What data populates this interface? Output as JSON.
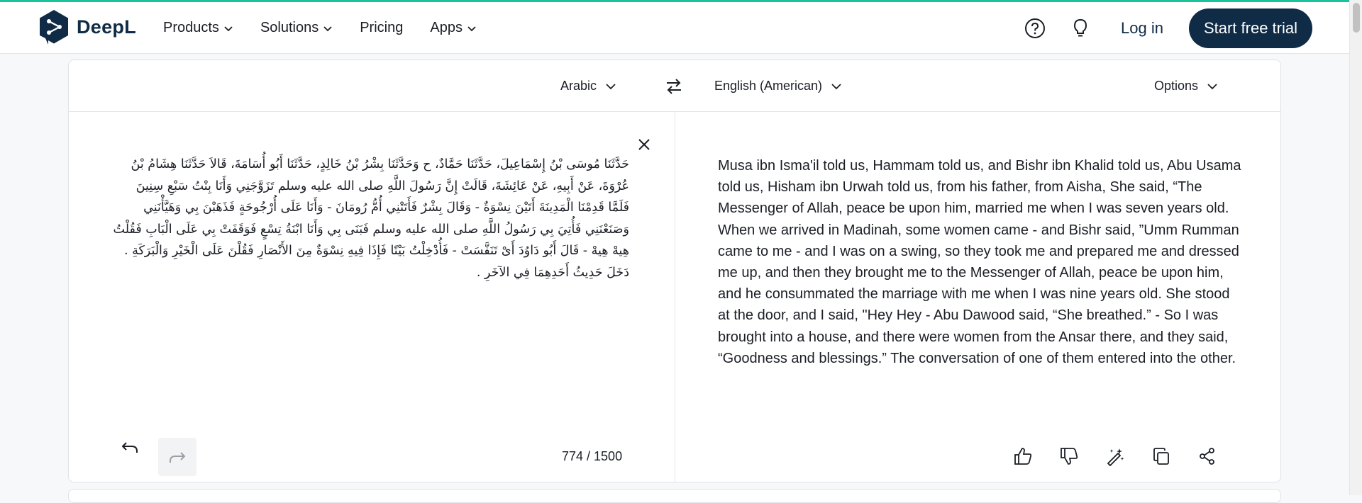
{
  "brand": {
    "name": "DeepL"
  },
  "nav": {
    "items": [
      {
        "label": "Products",
        "dropdown": true
      },
      {
        "label": "Solutions",
        "dropdown": true
      },
      {
        "label": "Pricing",
        "dropdown": false
      },
      {
        "label": "Apps",
        "dropdown": true
      }
    ],
    "login_label": "Log in",
    "trial_label": "Start free trial"
  },
  "translator": {
    "source_lang": "Arabic",
    "target_lang": "English (American)",
    "options_label": "Options",
    "source_text": "حَدَّثَنَا مُوسَى بْنُ إِسْمَاعِيلَ، حَدَّثَنَا حَمَّادٌ، ح وَحَدَّثَنَا بِشْرُ بْنُ خَالِدٍ، حَدَّثَنَا أَبُو أُسَامَةَ، قَالاَ حَدَّثَنَا هِشَامُ بْنُ عُرْوَةَ، عَنْ أَبِيهِ، عَنْ عَائِشَةَ، قَالَتْ إِنَّ رَسُولَ اللَّهِ صلى الله عليه وسلم تَزَوَّجَنِي وَأَنَا بِنْتُ سَبْعِ سِنِينَ فَلَمَّا قَدِمْنَا الْمَدِينَةَ أَتَيْنَ نِسْوَةٌ - وَقَالَ بِشْرٌ فَأَتَتْنِي أُمُّ رُومَانَ - وَأَنَا عَلَى أُرْجُوحَةٍ فَذَهَبْنَ بِي وَهَيَّأْنَنِي وَصَنَعْنَنِي فَأُتِيَ بِي رَسُولُ اللَّهِ صلى الله عليه وسلم فَبَنَى بِي وَأَنَا ابْنَةُ تِسْعٍ فَوَقَفَتْ بِي عَلَى الْبَابِ فَقُلْتُ هِيهْ هِيهْ - قَالَ أَبُو دَاوُدَ أَىْ تَنَفَّسَتْ - فَأُدْخِلْتُ بَيْتًا فَإِذَا فِيهِ نِسْوَةٌ مِنَ الأَنْصَارِ فَقُلْنَ عَلَى الْخَيْرِ وَالْبَرَكَةِ . دَخَلَ حَدِيثُ أَحَدِهِمَا فِي الآخَرِ .",
    "target_text": "Musa ibn Isma'il told us, Hammam told us, and Bishr ibn Khalid told us, Abu Usama told us, Hisham ibn Urwah told us, from his father, from Aisha, She said, “The Messenger of Allah, peace be upon him, married me when I was seven years old. When we arrived in Madinah, some women came - and Bishr said, ”Umm Rumman came to me - and I was on a swing, so they took me and prepared me and dressed me up, and then they brought me to the Messenger of Allah, peace be upon him, and he consummated the marriage with me when I was nine years old. She stood at the door, and I said, \"Hey Hey - Abu Dawood said, “She breathed.” - So I was brought into a house, and there were women from the Ansar there, and they said, “Goodness and blessings.” The conversation of one of them entered into the other.",
    "char_count": "774 / 1500"
  },
  "icons": {
    "help": "help-circle-icon",
    "tips": "lightbulb-icon",
    "swap": "swap-arrows-icon",
    "clear": "close-icon",
    "undo": "undo-icon",
    "redo": "redo-icon",
    "like": "thumbs-up-icon",
    "dislike": "thumbs-down-icon",
    "improve": "magic-wand-icon",
    "copy": "copy-icon",
    "share": "share-icon"
  },
  "colors": {
    "brand_navy": "#0f2b46",
    "accent_line": "#19c39c"
  }
}
